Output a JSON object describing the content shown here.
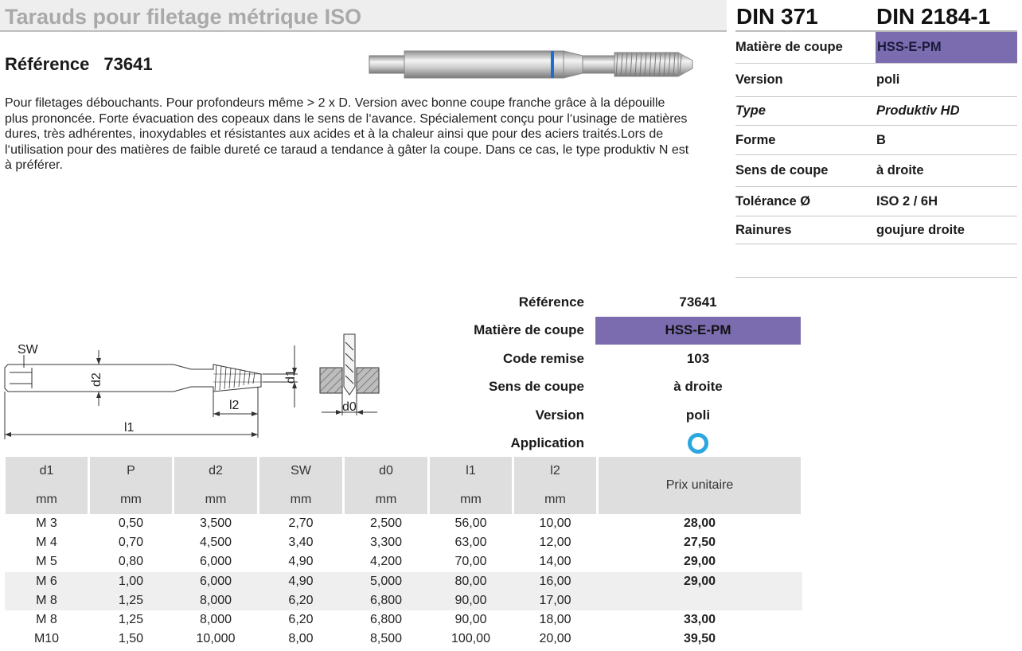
{
  "header": {
    "title": "Tarauds pour filetage métrique ISO",
    "din_1": "DIN 371",
    "din_2": "DIN 2184-1"
  },
  "reference": {
    "label": "Référence",
    "number": "73641"
  },
  "description": "Pour filetages débouchants. Pour profondeurs même > 2 x D. Version avec bonne coupe franche grâce à la dépouille plus prononcée. Forte évacuation des copeaux dans le sens de l‘avance. Spécialement conçu pour l‘usinage de matières dures, très adhérentes, inoxydables et résistantes aux acides et à la chaleur ainsi que pour des aciers traités.Lors de l‘utilisation pour des matières de faible dureté ce taraud a tendance à gâter la coupe. Dans ce cas, le type produktiv N est à préférer.",
  "properties": [
    {
      "key": "Matière de coupe",
      "value": "HSS-E-PM"
    },
    {
      "key": "Version",
      "value": "poli"
    },
    {
      "key": "Type",
      "value": "Produktiv HD"
    },
    {
      "key": "Forme",
      "value": "B"
    },
    {
      "key": "Sens de coupe",
      "value": "à droite"
    },
    {
      "key": "Tolérance Ø",
      "value": "ISO 2 / 6H"
    },
    {
      "key": "Rainures",
      "value": "goujure droite"
    }
  ],
  "drawing_labels": {
    "sw": "SW",
    "d2": "d2",
    "d1": "d1",
    "l2": "l2",
    "l1": "l1",
    "d0": "d0"
  },
  "spec": [
    {
      "key": "Référence",
      "value": "73641"
    },
    {
      "key": "Matière de coupe",
      "value": "HSS-E-PM"
    },
    {
      "key": "Code remise",
      "value": "103"
    },
    {
      "key": "Sens de coupe",
      "value": "à droite"
    },
    {
      "key": "Version",
      "value": "poli"
    },
    {
      "key": "Application",
      "value": ""
    }
  ],
  "colors": {
    "accent_purple": "#7b6cb0",
    "application_ring": "#2aa7df",
    "header_bg": "#eeeeee"
  },
  "table": {
    "headers": [
      "d1",
      "P",
      "d2",
      "SW",
      "d0",
      "l1",
      "l2"
    ],
    "units": [
      "mm",
      "mm",
      "mm",
      "mm",
      "mm",
      "mm",
      "mm"
    ],
    "price_header": "Prix unitaire",
    "rows": [
      [
        "M 3",
        "0,50",
        "3,500",
        "2,70",
        "2,500",
        "56,00",
        "10,00",
        "28,00"
      ],
      [
        "M 4",
        "0,70",
        "4,500",
        "3,40",
        "3,300",
        "63,00",
        "12,00",
        "27,50"
      ],
      [
        "M 5",
        "0,80",
        "6,000",
        "4,90",
        "4,200",
        "70,00",
        "14,00",
        "29,00"
      ],
      [
        "M 6",
        "1,00",
        "6,000",
        "4,90",
        "5,000",
        "80,00",
        "16,00",
        "29,00"
      ],
      [
        "M 8",
        "1,25",
        "8,000",
        "6,20",
        "6,800",
        "90,00",
        "17,00",
        ""
      ],
      [
        "M 8",
        "1,25",
        "8,000",
        "6,20",
        "6,800",
        "90,00",
        "18,00",
        "33,00"
      ],
      [
        "M10",
        "1,50",
        "10,000",
        "8,00",
        "8,500",
        "100,00",
        "20,00",
        "39,50"
      ]
    ]
  }
}
